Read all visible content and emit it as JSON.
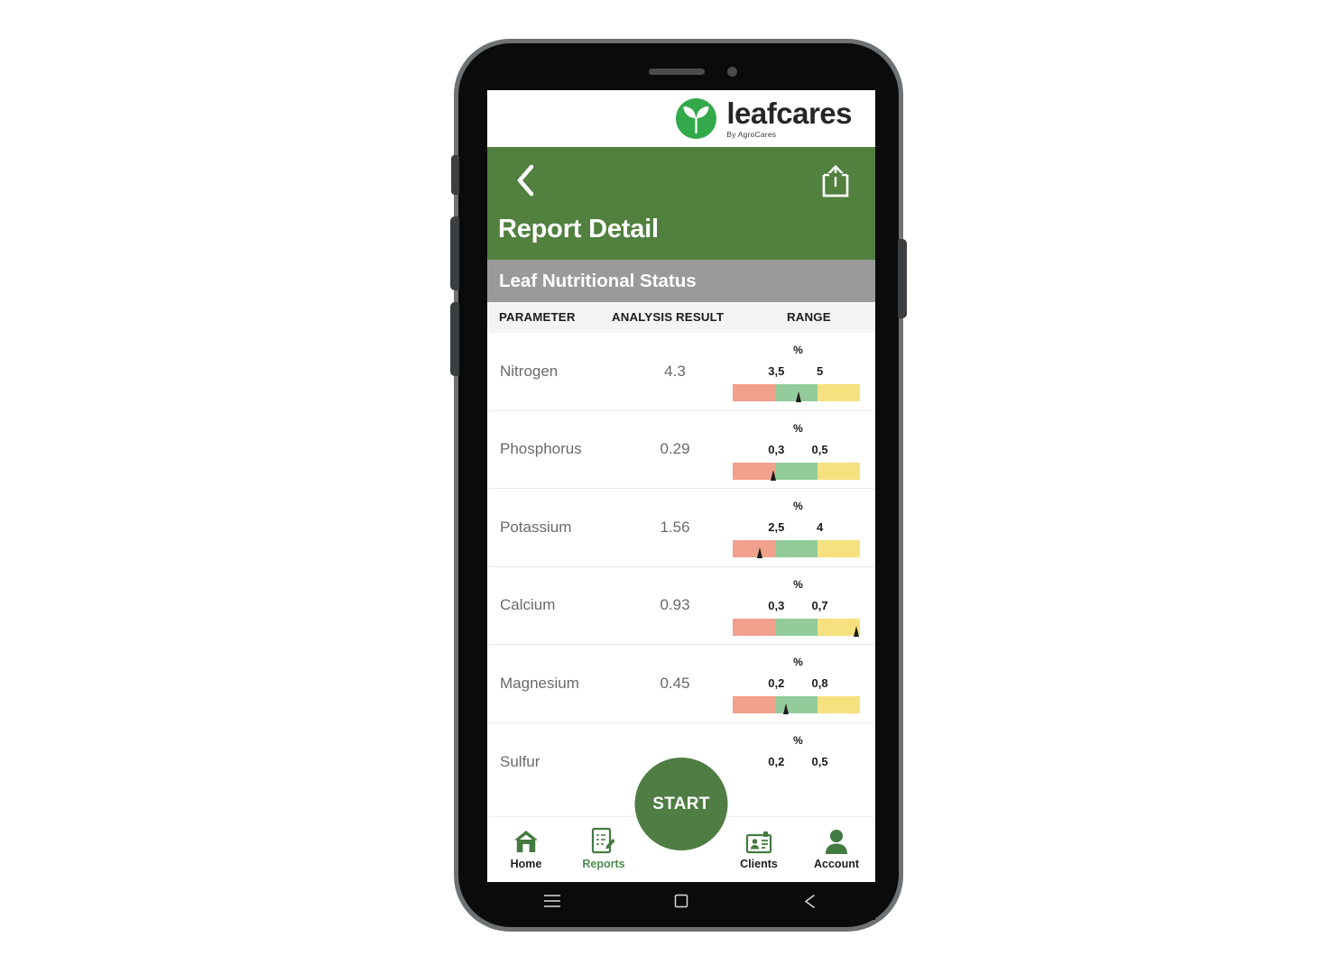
{
  "brand": {
    "logo_icon": "leaf-sprout-icon",
    "name": "leafcares",
    "tagline": "By AgroCares",
    "logo_color": "#33a94b"
  },
  "header": {
    "back_icon": "chevron-left-icon",
    "share_icon": "share-up-icon",
    "title": "Report Detail",
    "background_color": "#51803f"
  },
  "section": {
    "title": "Leaf Nutritional Status",
    "background_color": "#9a9a9a"
  },
  "table": {
    "columns": [
      "PARAMETER",
      "ANALYSIS RESULT",
      "RANGE"
    ],
    "unit_label": "%",
    "segment_colors": {
      "low": "#f0a08d",
      "optimal": "#93cb9b",
      "high": "#f7e07e"
    },
    "rows": [
      {
        "parameter": "Nitrogen",
        "result": "4.3",
        "unit": "%",
        "low_threshold": "3,5",
        "high_threshold": "5",
        "marker_percent": 52
      },
      {
        "parameter": "Phosphorus",
        "result": "0.29",
        "unit": "%",
        "low_threshold": "0,3",
        "high_threshold": "0,5",
        "marker_percent": 32
      },
      {
        "parameter": "Potassium",
        "result": "1.56",
        "unit": "%",
        "low_threshold": "2,5",
        "high_threshold": "4",
        "marker_percent": 21
      },
      {
        "parameter": "Calcium",
        "result": "0.93",
        "unit": "%",
        "low_threshold": "0,3",
        "high_threshold": "0,7",
        "marker_percent": 97
      },
      {
        "parameter": "Magnesium",
        "result": "0.45",
        "unit": "%",
        "low_threshold": "0,2",
        "high_threshold": "0,8",
        "marker_percent": 42
      },
      {
        "parameter": "Sulfur",
        "result": "",
        "unit": "%",
        "low_threshold": "0,2",
        "high_threshold": "0,5",
        "marker_percent": null
      }
    ]
  },
  "start_button": {
    "label": "START",
    "color": "#4f7d43"
  },
  "bottom_nav": {
    "items": [
      {
        "label": "Home",
        "icon": "home-icon",
        "active": false
      },
      {
        "label": "Reports",
        "icon": "report-edit-icon",
        "active": true
      },
      {
        "label": "Clients",
        "icon": "id-card-icon",
        "active": false
      },
      {
        "label": "Account",
        "icon": "person-icon",
        "active": false
      }
    ],
    "active_color": "#4f8b4f"
  },
  "system_bar": {
    "buttons": [
      "menu-icon",
      "home-square-icon",
      "back-triangle-icon"
    ]
  }
}
